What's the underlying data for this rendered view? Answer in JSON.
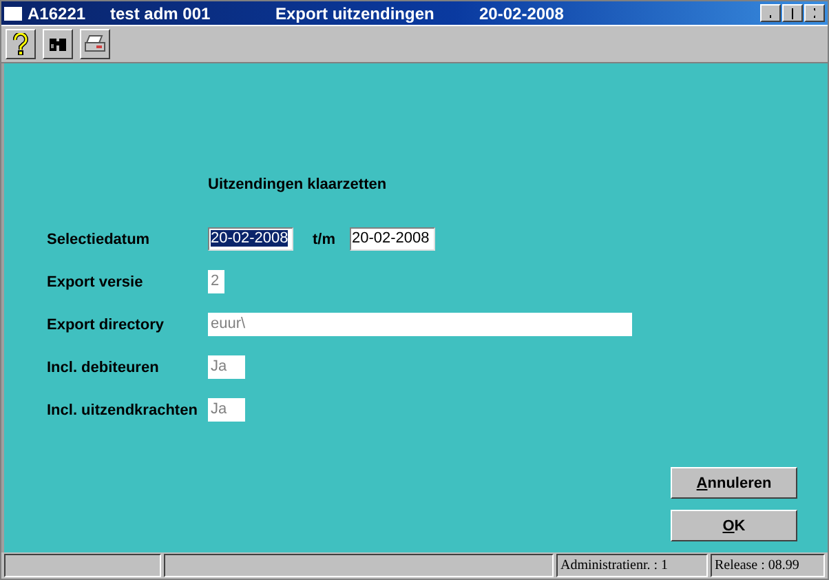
{
  "window": {
    "title_parts": [
      "A16221",
      "test adm 001",
      "Export uitzendingen",
      "20-02-2008"
    ]
  },
  "toolbar": [
    {
      "kind": "help"
    },
    {
      "kind": "binoculars"
    },
    {
      "kind": "printer"
    }
  ],
  "form": {
    "heading": "Uitzendingen klaarzetten",
    "rows": [
      {
        "label": "Selectiedatum",
        "fields": [
          {
            "value": "20-02-2008",
            "selected": true,
            "disabled": false
          },
          {
            "value": "20-02-2008",
            "selected": false,
            "disabled": false
          }
        ],
        "separator": "t/m"
      },
      {
        "label": "Export versie",
        "fields": [
          {
            "value": "2",
            "selected": false,
            "disabled": true
          }
        ]
      },
      {
        "label": "Export directory",
        "fields": [
          {
            "value": "euur\\",
            "selected": false,
            "disabled": true
          }
        ]
      },
      {
        "label": "Incl. debiteuren",
        "fields": [
          {
            "value": "Ja",
            "selected": false,
            "disabled": true
          }
        ]
      },
      {
        "label": "Incl. uitzendkrachten",
        "fields": [
          {
            "value": "Ja",
            "selected": false,
            "disabled": true
          }
        ]
      }
    ]
  },
  "buttons": [
    "Annuleren",
    "OK"
  ],
  "status_bar": [
    "Administratienr. :  1",
    "Release : 08.99"
  ]
}
